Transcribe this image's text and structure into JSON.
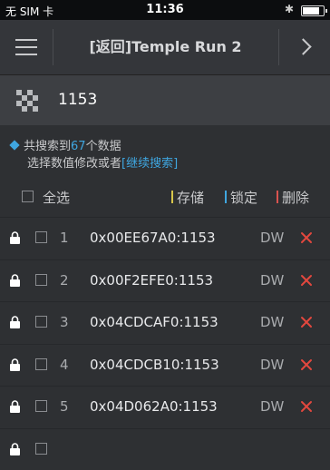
{
  "status_bar": {
    "carrier": "无 SIM 卡",
    "time": "11:36",
    "battery_level": 0.9
  },
  "nav": {
    "title": "[返回]Temple Run 2",
    "menu_icon": "hamburger-icon",
    "next_icon": "chevron-right-icon"
  },
  "search": {
    "value": "1153"
  },
  "info": {
    "prefix": "共搜索到",
    "count": "67",
    "suffix": "个数据",
    "line2": "选择数值修改或者",
    "link": "[继续搜索]"
  },
  "header": {
    "select_all": "全选",
    "actions": [
      {
        "label": "存储",
        "color": "#d7c64a"
      },
      {
        "label": "锁定",
        "color": "#3fa6e0"
      },
      {
        "label": "删除",
        "color": "#d9534f"
      }
    ]
  },
  "rows": [
    {
      "num": "1",
      "address": "0x00EE67A0:1153",
      "type": "DW"
    },
    {
      "num": "2",
      "address": "0x00F2EFE0:1153",
      "type": "DW"
    },
    {
      "num": "3",
      "address": "0x04CDCAF0:1153",
      "type": "DW"
    },
    {
      "num": "4",
      "address": "0x04CDCB10:1153",
      "type": "DW"
    },
    {
      "num": "5",
      "address": "0x04D062A0:1153",
      "type": "DW"
    },
    {
      "num": "",
      "address": "",
      "type": ""
    }
  ],
  "colors": {
    "accent": "#3fa6e0",
    "delete": "#e2473e",
    "background": "#2e3033"
  }
}
